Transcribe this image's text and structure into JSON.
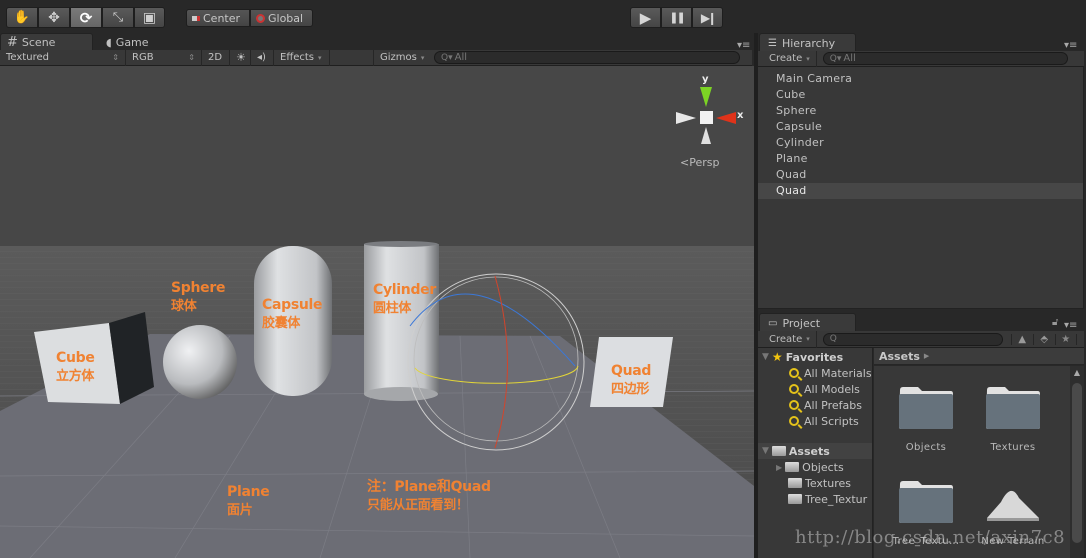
{
  "toolbar": {
    "tools": [
      {
        "name": "hand-tool",
        "icon": "hand-icon",
        "glyph": "✋"
      },
      {
        "name": "move-tool",
        "icon": "move-icon",
        "glyph": "✥"
      },
      {
        "name": "rotate-tool",
        "icon": "rotate-icon",
        "glyph": "⟳",
        "active": true
      },
      {
        "name": "scale-tool",
        "icon": "scale-icon",
        "glyph": "⤡"
      },
      {
        "name": "rect-tool",
        "icon": "rect-icon",
        "glyph": "▣"
      }
    ],
    "pivot_label": "Center",
    "space_label": "Global",
    "play_glyph": "▶",
    "pause_glyph": "❚❚",
    "step_glyph": "▶❙"
  },
  "scene_tabs": {
    "scene_label": "Scene",
    "game_label": "Game"
  },
  "scene_bar": {
    "shading_mode": "Textured",
    "render_mode": "RGB",
    "mode_2d": "2D",
    "effects_label": "Effects",
    "gizmos_label": "Gizmos",
    "search_placeholder": "All"
  },
  "gizmo": {
    "y_label": "y",
    "x_label": "x",
    "projection_label": "Persp",
    "colors": {
      "y": "#7cd424",
      "x": "#e0331a"
    }
  },
  "scene_labels": {
    "cube": {
      "en": "Cube",
      "zh": "立方体"
    },
    "sphere": {
      "en": "Sphere",
      "zh": "球体"
    },
    "capsule": {
      "en": "Capsule",
      "zh": "胶囊体"
    },
    "cylinder": {
      "en": "Cylinder",
      "zh": "圆柱体"
    },
    "quad": {
      "en": "Quad",
      "zh": "四边形"
    },
    "plane": {
      "en": "Plane",
      "zh": "面片"
    },
    "note": {
      "line1": "注：Plane和Quad",
      "line2": "只能从正面看到！"
    },
    "label_color": "#f08232"
  },
  "hierarchy": {
    "tab_label": "Hierarchy",
    "create_label": "Create",
    "search_placeholder": "All",
    "items": [
      {
        "label": "Main Camera",
        "selected": false
      },
      {
        "label": "Cube",
        "selected": false
      },
      {
        "label": "Sphere",
        "selected": false
      },
      {
        "label": "Capsule",
        "selected": false
      },
      {
        "label": "Cylinder",
        "selected": false
      },
      {
        "label": "Plane",
        "selected": false
      },
      {
        "label": "Quad",
        "selected": false
      },
      {
        "label": "Quad",
        "selected": true
      }
    ]
  },
  "project": {
    "tab_label": "Project",
    "create_label": "Create",
    "search_placeholder": "",
    "favorites_label": "Favorites",
    "favorites": [
      "All Materials",
      "All Models",
      "All Prefabs",
      "All Scripts"
    ],
    "assets_label": "Assets",
    "asset_tree": [
      {
        "label": "Objects",
        "expandable": true
      },
      {
        "label": "Textures",
        "expandable": false
      },
      {
        "label": "Tree_Textur",
        "expandable": false
      }
    ],
    "breadcrumb": "Assets",
    "grid_items": [
      {
        "label": "Objects",
        "type": "folder"
      },
      {
        "label": "Textures",
        "type": "folder"
      },
      {
        "label": "Tree_Textu…",
        "type": "folder"
      },
      {
        "label": "New Terrain",
        "type": "terrain"
      }
    ]
  },
  "watermark": "http://blog.csdn.net/axin7c8"
}
